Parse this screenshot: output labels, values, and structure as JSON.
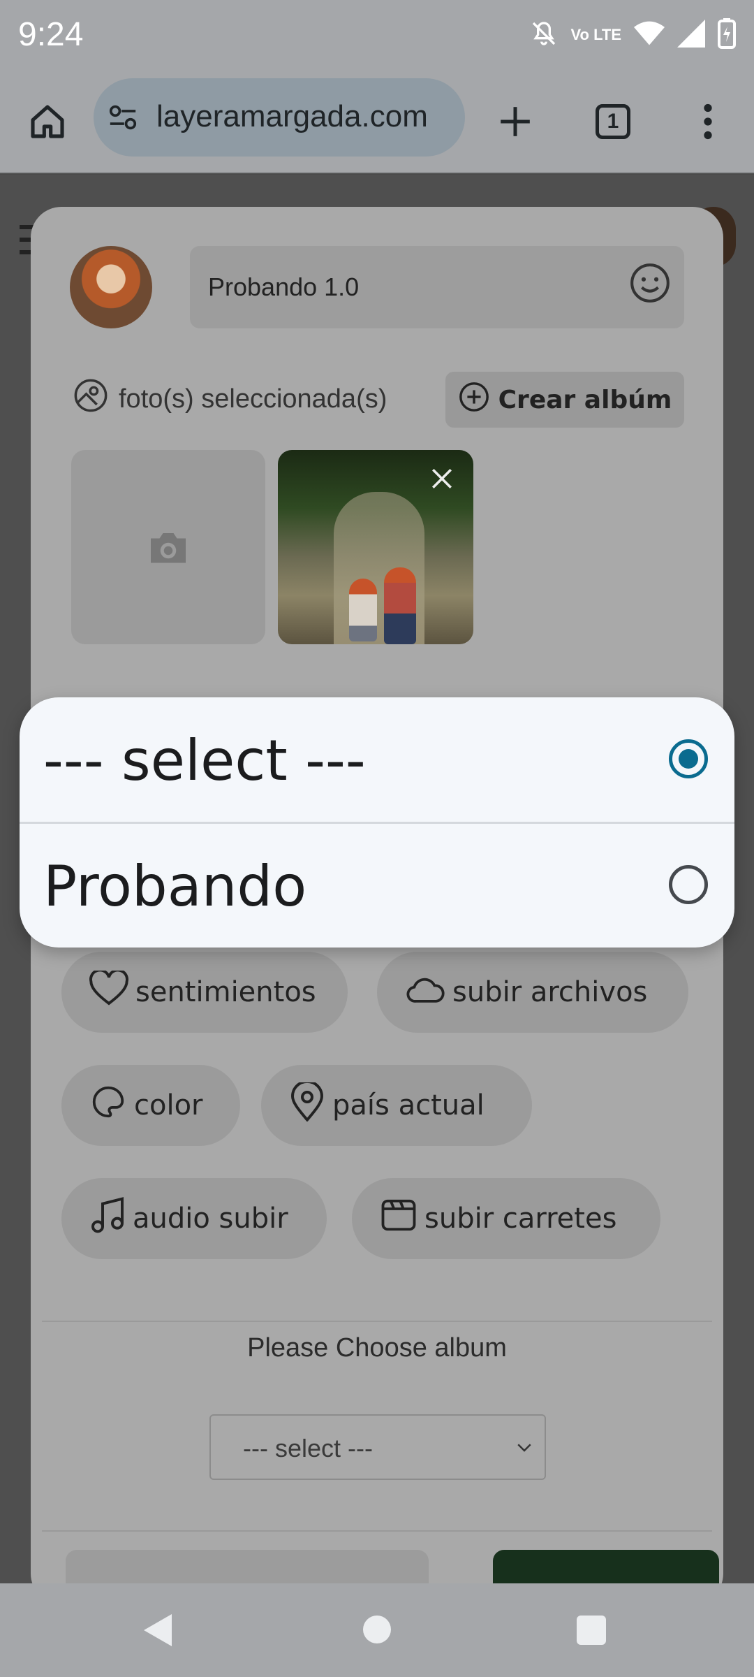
{
  "status_bar": {
    "time": "9:24",
    "network_label": "Vo LTE",
    "icons": [
      "mute-icon",
      "volte-icon",
      "wifi-icon",
      "signal-icon",
      "battery-icon"
    ]
  },
  "browser": {
    "url": "layeramargada.com",
    "tab_count": "1",
    "icons": [
      "home-icon",
      "site-settings-icon",
      "new-tab-icon",
      "tabs-icon",
      "more-menu-icon"
    ]
  },
  "post_form": {
    "text_value": "Probando 1.0",
    "selected_photos_label": "foto(s) seleccionada(s)",
    "create_album_label": "Crear albúm",
    "chips": [
      {
        "label": "sentimientos",
        "icon": "heart-icon"
      },
      {
        "label": "subir archivos",
        "icon": "cloud-icon"
      },
      {
        "label": "color",
        "icon": "palette-icon"
      },
      {
        "label": "país actual",
        "icon": "location-icon"
      },
      {
        "label": "audio subir",
        "icon": "music-note-icon"
      },
      {
        "label": "subir carretes",
        "icon": "clapperboard-icon"
      }
    ],
    "choose_album_label": "Please Choose album",
    "album_select_value": "--- select ---"
  },
  "album_picker": {
    "options": [
      {
        "label": "--- select ---",
        "selected": true
      },
      {
        "label": "Probando",
        "selected": false
      }
    ]
  },
  "colors": {
    "radio_selected": "#0a6b8f",
    "primary_button": "#17301c"
  }
}
